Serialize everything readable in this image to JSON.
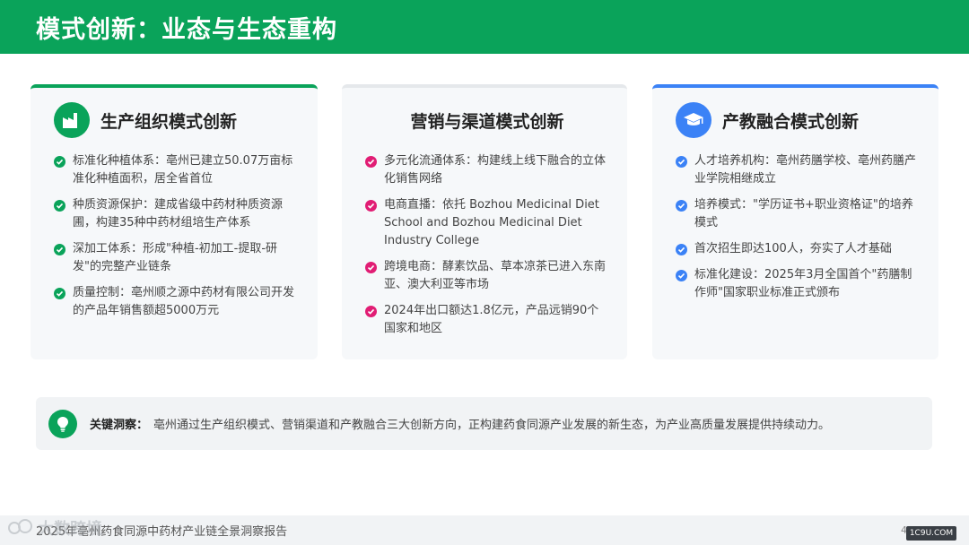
{
  "header": {
    "title": "模式创新：业态与生态重构"
  },
  "cards": [
    {
      "title": "生产组织模式创新",
      "icon": "factory-icon",
      "accent": "#0aa35a",
      "items": [
        "标准化种植体系：亳州已建立50.07万亩标准化种植面积，居全省首位",
        "种质资源保护：建成省级中药材种质资源圃，构建35种中药材组培生产体系",
        "深加工体系：形成\"种植-初加工-提取-研发\"的完整产业链条",
        "质量控制：亳州顺之源中药材有限公司开发的产品年销售额超5000万元"
      ]
    },
    {
      "title": "营销与渠道模式创新",
      "accent": "#e11d74",
      "items": [
        "多元化流通体系：构建线上线下融合的立体化销售网络",
        "电商直播：依托 Bozhou Medicinal Diet School and Bozhou Medicinal Diet Industry College",
        "跨境电商：酵素饮品、草本凉茶已进入东南亚、澳大利亚等市场",
        "2024年出口额达1.8亿元，产品远销90个国家和地区"
      ]
    },
    {
      "title": "产教融合模式创新",
      "icon": "graduation-cap-icon",
      "accent": "#3b82f6",
      "items": [
        "人才培养机构：亳州药膳学校、亳州药膳产业学院相继成立",
        "培养模式：\"学历证书+职业资格证\"的培养模式",
        "首次招生即达100人，夯实了人才基础",
        "标准化建设：2025年3月全国首个\"药膳制作师\"国家职业标准正式颁布"
      ]
    }
  ],
  "insight": {
    "icon": "lightbulb-icon",
    "label": "关键洞察：",
    "text": "亳州通过生产组织模式、营销渠道和产教融合三大创新方向，正构建药食同源产业发展的新生态，为产业高质量发展提供持续动力。"
  },
  "footer": {
    "text": "2025年亳州药食同源中药材产业链全景洞察报告",
    "page": "4",
    "badge": "1C9U.COM"
  },
  "watermark": {
    "text": "大数跨境"
  }
}
